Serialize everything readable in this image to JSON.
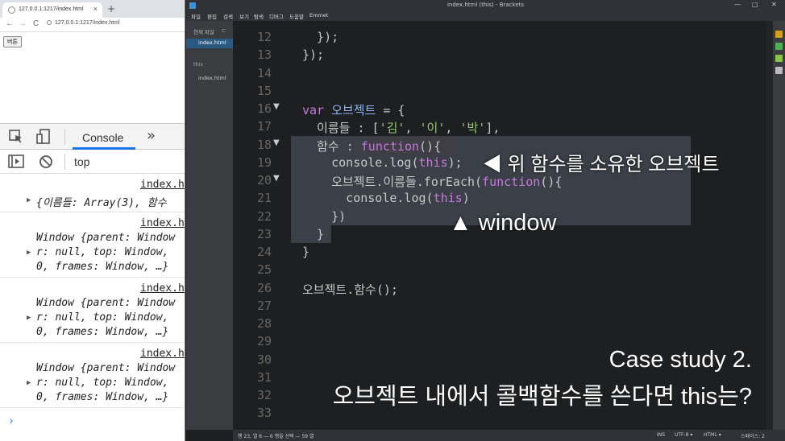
{
  "browser": {
    "tab_title": "127.0.0.1:1217/index.html",
    "tab_close": "×",
    "new_tab": "+",
    "back": "←",
    "forward": "→",
    "reload": "C",
    "url": "127.0.0.1:1217/index.html",
    "page_button": "버튼"
  },
  "devtools": {
    "console_tab": "Console",
    "more": "»",
    "context": "top",
    "prompt": "›",
    "logs": [
      {
        "source": "index.h",
        "lines": [
          "{이름들: Array(3), 함수"
        ]
      },
      {
        "source": "index.h",
        "lines": [
          "Window {parent: Window",
          "r: null, top: Window,",
          "0, frames: Window, …}"
        ]
      },
      {
        "source": "index.h",
        "lines": [
          "Window {parent: Window",
          "r: null, top: Window,",
          "0, frames: Window, …}"
        ]
      },
      {
        "source": "index.h",
        "lines": [
          "Window {parent: Window",
          "r: null, top: Window,",
          "0, frames: Window, …}"
        ]
      }
    ]
  },
  "editor": {
    "window_title": "index.html (this) - Brackets",
    "win_min": "—",
    "win_max": "□",
    "win_close": "✕",
    "menu": [
      "파일",
      "편집",
      "검색",
      "보기",
      "탐색",
      "디버그",
      "도움말",
      "Emmet"
    ],
    "sidebar": {
      "working_files": "현재 파일",
      "split_icon": "⊏",
      "active_file": "index.html",
      "project": "this ·",
      "project_file": "index.html"
    },
    "line_numbers": [
      "12",
      "13",
      "14",
      "15",
      "16",
      "17",
      "18",
      "19",
      "20",
      "21",
      "22",
      "23",
      "24",
      "25",
      "26",
      "27",
      "28",
      "29",
      "30",
      "31",
      "32",
      "33"
    ],
    "code": {
      "l12": "  });",
      "l13": "});",
      "l16_kw": "var",
      "l16_var": " 오브젝트",
      "l16_rest": " = {",
      "l17_a": "  이름들 : [",
      "l17_s1": "'김'",
      "l17_c1": ", ",
      "l17_s2": "'이'",
      "l17_c2": ", ",
      "l17_s3": "'박'",
      "l17_e": "],",
      "l18_a": "  함수 : ",
      "l18_kw": "function",
      "l18_e": "(){",
      "l19_a": "    console.log(",
      "l19_kw": "this",
      "l19_e": ");",
      "l20_a": "    오브젝트.이름들.forEach(",
      "l20_kw": "function",
      "l20_e": "(){",
      "l21_a": "      console.log(",
      "l21_kw": "this",
      "l21_e": ")",
      "l22": "    })",
      "l23": "  }",
      "l24": "}",
      "l26": "오브젝트.함수();"
    },
    "annotations": {
      "note1": "◀ 위 함수를 소유한 오브젝트",
      "note2": "▲ window"
    },
    "caption": {
      "line1": "Case study 2.",
      "line2": "오브젝트 내에서 콜백함수를 쓴다면 this는?"
    },
    "status": {
      "position": "행 23, 열 6 — 6 행을 선택 — 59 열",
      "ins": "INS",
      "encoding": "UTF-8 ▾",
      "language": "HTML ▾",
      "spaces": "스페이스: 2"
    }
  },
  "colors": {
    "keyword": "#c678dd",
    "string": "#98c379",
    "variable": "#8ab4f8",
    "devtools_accent": "#1a73e8"
  }
}
